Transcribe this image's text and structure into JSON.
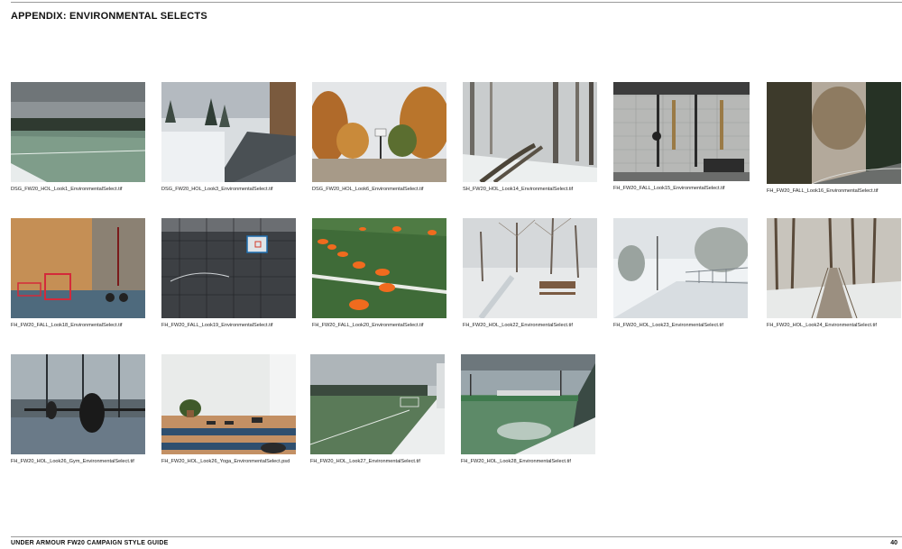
{
  "page": {
    "title": "APPENDIX: ENVIRONMENTAL SELECTS",
    "footer": "UNDER ARMOUR FW20 CAMPAIGN STYLE GUIDE",
    "page_number": "40"
  },
  "selects": [
    {
      "filename": "DSG_FW20_HOL_Look1_EnvironmentalSelect.tif",
      "scene": "snowy-soccer-field"
    },
    {
      "filename": "DSG_FW20_HOL_Look3_EnvironmentalSelect.tif",
      "scene": "snowy-road"
    },
    {
      "filename": "DSG_FW20_HOL_Look6_EnvironmentalSelect.tif",
      "scene": "autumn-basketball-court"
    },
    {
      "filename": "SH_FW20_HOL_Look14_EnvironmentalSelect.tif",
      "scene": "foggy-snow-forest-path"
    },
    {
      "filename": "FH_FW20_FALL_Look15_EnvironmentalSelect.tif",
      "scene": "gym-wall-equipment"
    },
    {
      "filename": "FH_FW20_FALL_Look16_EnvironmentalSelect.tif",
      "scene": "mountain-road-forest"
    },
    {
      "filename": "FH_FW20_FALL_Look18_EnvironmentalSelect.tif",
      "scene": "gym-plyo-boxes"
    },
    {
      "filename": "FH_FW20_FALL_Look19_EnvironmentalSelect.tif",
      "scene": "caged-basketball-court"
    },
    {
      "filename": "FH_FW20_FALL_Look20_EnvironmentalSelect.tif",
      "scene": "turf-training-cones"
    },
    {
      "filename": "FH_FW20_HOL_Look22_EnvironmentalSelect.tif",
      "scene": "snowy-park-bench"
    },
    {
      "filename": "FH_FW20_HOL_Look23_EnvironmentalSelect.tif",
      "scene": "snowy-bridge"
    },
    {
      "filename": "FH_FW20_HOL_Look24_EnvironmentalSelect.tif",
      "scene": "snowy-boardwalk-forest"
    },
    {
      "filename": "FH_FW20_HOL_Look26_Gym_EnvironmentalSelect.tif",
      "scene": "gym-barbell"
    },
    {
      "filename": "FH_FW20_HOL_Look26_Yoga_EnvironmentalSelect.psd",
      "scene": "yoga-studio"
    },
    {
      "filename": "FH_FW20_HOL_Look27_EnvironmentalSelect.tif",
      "scene": "snowy-field-goal"
    },
    {
      "filename": "FH_FW20_HOL_Look28_EnvironmentalSelect.tif",
      "scene": "snowy-stadium-field"
    }
  ]
}
